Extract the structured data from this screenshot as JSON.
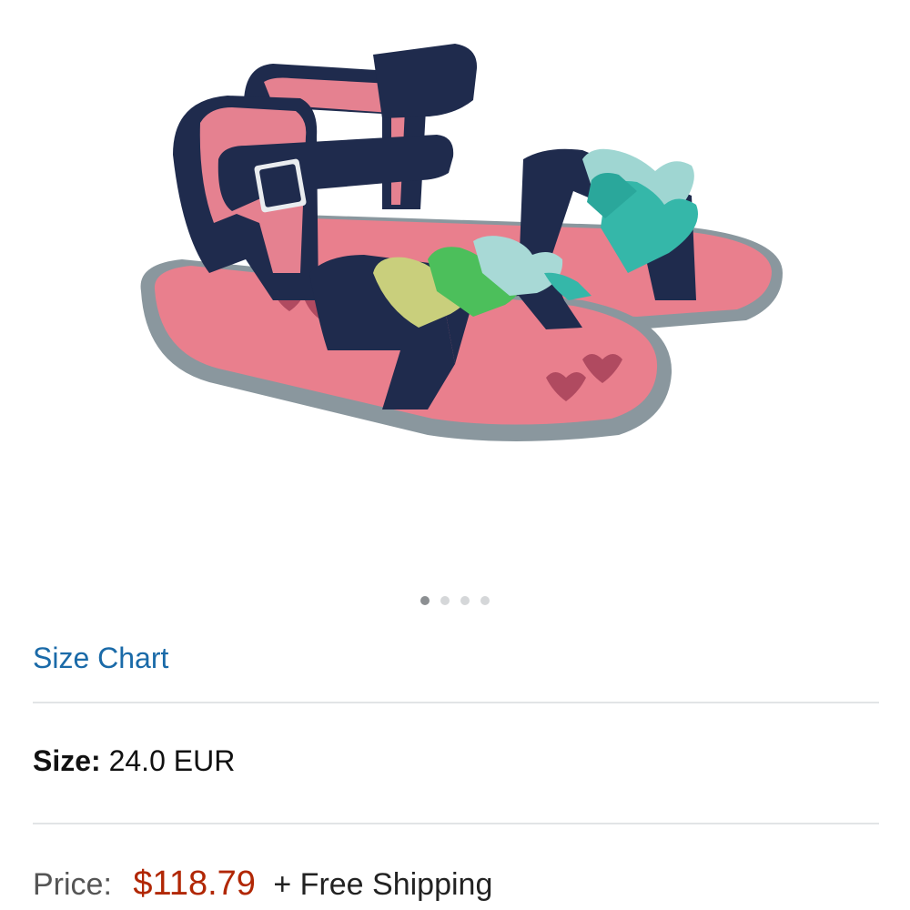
{
  "product": {
    "image_description_icon": "sandal-product-image",
    "carousel": {
      "total": 4,
      "active_index": 0
    }
  },
  "links": {
    "size_chart": "Size Chart"
  },
  "size": {
    "label": "Size:",
    "value": "24.0 EUR"
  },
  "price": {
    "label": "Price:",
    "value": "$118.79",
    "shipping": "+ Free Shipping"
  },
  "colors": {
    "link": "#1a6aa8",
    "price": "#b12704"
  }
}
